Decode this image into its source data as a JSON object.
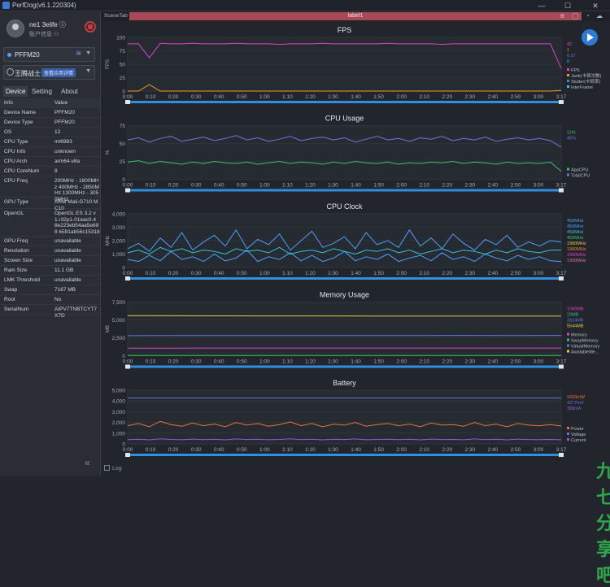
{
  "window": {
    "title": "PerfDog(v6.1.220304)",
    "min": "—",
    "max": "☐",
    "close": "✕"
  },
  "user": {
    "name": "ne1 3elife ⓘ",
    "account": "账户信息 ⚇"
  },
  "device_select": {
    "value": "PFFM20"
  },
  "app_select": {
    "value": "王腾战士",
    "tag": "查看应用详情"
  },
  "tabs": [
    "Device",
    "Setting",
    "About"
  ],
  "info_header": {
    "k": "Info",
    "v": "Value"
  },
  "info_rows": [
    {
      "k": "Device Name",
      "v": "PFFM20"
    },
    {
      "k": "Device Type",
      "v": "PFFM20"
    },
    {
      "k": "OS",
      "v": "12"
    },
    {
      "k": "CPU Type",
      "v": "mt6983"
    },
    {
      "k": "CPU Info",
      "v": "unknown"
    },
    {
      "k": "CPU Arch",
      "v": "arm64-v8a"
    },
    {
      "k": "CPU CoreNum",
      "v": "8"
    },
    {
      "k": "CPU Freq",
      "v": "200MHz - 1800MHz 400MHz - 2850MHz 1300MHz - 3050MHz"
    },
    {
      "k": "GPU Type",
      "v": "ARM Mali-G710 MC10"
    },
    {
      "k": "OpenGL",
      "v": "OpenGL ES 3.2 v1.r32p1-01eac0.4 8e223eb54aa5e698 6591ab56c15318"
    },
    {
      "k": "GPU Freq",
      "v": "unavailable"
    },
    {
      "k": "Resolution",
      "v": "unavailable"
    },
    {
      "k": "Screen Size",
      "v": "unavailable"
    },
    {
      "k": "Ram Size",
      "v": "11.1 GB"
    },
    {
      "k": "LMK Threshold",
      "v": "unavailable"
    },
    {
      "k": "Swap",
      "v": "7167 MB"
    },
    {
      "k": "Root",
      "v": "No"
    },
    {
      "k": "SerialNum",
      "v": "AIPV7TNBTCYT7X7D"
    }
  ],
  "scene": {
    "tab": "SceneTab",
    "label": "label1",
    "icons": "⊕ ◯ ◔ ☁"
  },
  "log": {
    "label": "Log"
  },
  "watermark": "九七分享吧",
  "x_ticks": [
    "0:00",
    "0:10",
    "0:20",
    "0:30",
    "0:40",
    "0:50",
    "1:00",
    "1:10",
    "1:20",
    "1:30",
    "1:40",
    "1:50",
    "2:00",
    "2:10",
    "2:20",
    "2:30",
    "2:40",
    "2:50",
    "3:00",
    "3:17"
  ],
  "chart_data": [
    {
      "type": "line",
      "title": "FPS",
      "ylabel": "FPS",
      "ylim": [
        0,
        100
      ],
      "yticks": [
        "0",
        "25",
        "50",
        "75",
        "100"
      ],
      "legend_values": [
        "42",
        "1",
        "6.37",
        "0"
      ],
      "legend": [
        "FPS",
        "Jank(卡顿次数)",
        "Stutter(卡顿率)",
        "InterFrame"
      ],
      "colors": [
        "#e040c8",
        "#f0a020",
        "#5a7ad8",
        "#30c8d8"
      ],
      "series": [
        {
          "name": "FPS",
          "values": [
            88,
            88,
            62,
            89,
            88,
            88,
            89,
            88,
            88,
            88,
            89,
            88,
            88,
            88,
            87,
            88,
            88,
            88,
            89,
            88,
            88,
            88,
            88,
            88,
            89,
            88,
            88,
            88,
            88,
            87,
            88,
            88,
            88,
            88,
            88,
            88,
            88,
            88,
            88,
            88,
            42
          ]
        },
        {
          "name": "Jank",
          "values": [
            0,
            0,
            12,
            0,
            0,
            0,
            0,
            0,
            0,
            0,
            0,
            0,
            0,
            0,
            0,
            0,
            0,
            0,
            0,
            0,
            0,
            0,
            0,
            0,
            0,
            0,
            0,
            0,
            0,
            0,
            0,
            0,
            0,
            0,
            0,
            0,
            0,
            0,
            0,
            0,
            1
          ]
        }
      ]
    },
    {
      "type": "line",
      "title": "CPU Usage",
      "ylabel": "%",
      "ylim": [
        0,
        75
      ],
      "yticks": [
        "0",
        "25",
        "50",
        "75"
      ],
      "legend_values": [
        "11%",
        "45%"
      ],
      "legend": [
        "AppCPU",
        "TotalCPU"
      ],
      "colors": [
        "#40c070",
        "#7a70e0"
      ],
      "series": [
        {
          "name": "AppCPU",
          "values": [
            24,
            26,
            22,
            25,
            23,
            21,
            24,
            22,
            25,
            23,
            22,
            24,
            21,
            23,
            25,
            22,
            24,
            23,
            21,
            24,
            22,
            25,
            23,
            22,
            24,
            21,
            23,
            22,
            24,
            23,
            25,
            22,
            24,
            23,
            21,
            24,
            22,
            23,
            22,
            24,
            11
          ]
        },
        {
          "name": "TotalCPU",
          "values": [
            55,
            58,
            52,
            57,
            60,
            53,
            56,
            59,
            54,
            57,
            61,
            55,
            58,
            53,
            56,
            60,
            54,
            57,
            59,
            55,
            58,
            52,
            56,
            60,
            55,
            57,
            53,
            58,
            56,
            60,
            54,
            57,
            55,
            59,
            53,
            56,
            58,
            55,
            57,
            54,
            45
          ]
        }
      ]
    },
    {
      "type": "line",
      "title": "CPU Clock",
      "ylabel": "MHz",
      "ylim": [
        0,
        4000
      ],
      "yticks": [
        "0",
        "1,000",
        "2,000",
        "3,000",
        "4,000"
      ],
      "legend_values": [
        "450MHz",
        "450MHz",
        "450MHz",
        "450MHz",
        "1900MHz",
        "1900MHz",
        "1900MHz",
        "1300MHz"
      ],
      "colors": [
        "#4aa0ff",
        "#4aa0ff",
        "#30c8d8",
        "#40c070",
        "#e8d040",
        "#f08030",
        "#e040c8",
        "#f07090"
      ],
      "series": [
        {
          "name": "CPU0",
          "values": [
            600,
            450,
            900,
            500,
            1200,
            600,
            800,
            450,
            1000,
            500,
            700,
            1300,
            450,
            800,
            600,
            1100,
            500,
            900,
            450,
            700,
            1200,
            500,
            800,
            600,
            1000,
            450,
            700,
            900,
            500,
            1100,
            600,
            800,
            450,
            1000,
            700,
            500,
            900,
            600,
            800,
            500,
            450
          ]
        },
        {
          "name": "CPU4",
          "values": [
            1400,
            1800,
            1200,
            2200,
            1500,
            2600,
            1300,
            1900,
            2400,
            1600,
            2800,
            1400,
            2100,
            1700,
            2500,
            1300,
            2000,
            2700,
            1500,
            1800,
            2300,
            1400,
            2600,
            1700,
            2000,
            1500,
            2800,
            1600,
            2200,
            1400,
            2500,
            1800,
            1300,
            2100,
            1700,
            2400,
            1500,
            1900,
            1600,
            2000,
            1900
          ]
        },
        {
          "name": "CPU7",
          "values": [
            1100,
            1300,
            1000,
            1500,
            1200,
            1400,
            1100,
            1300,
            1200,
            1000,
            1400,
            1200,
            1300,
            1100,
            1500,
            1000,
            1200,
            1300,
            1100,
            1400,
            1200,
            1000,
            1300,
            1200,
            1400,
            1100,
            1300,
            1000,
            1200,
            1400,
            1100,
            1300,
            1200,
            1000,
            1300,
            1100,
            1400,
            1200,
            1100,
            1300,
            1300
          ]
        }
      ]
    },
    {
      "type": "line",
      "title": "Memory Usage",
      "ylabel": "MB",
      "ylim": [
        0,
        7500
      ],
      "yticks": [
        "0",
        "2,500",
        "5,000",
        "7,500"
      ],
      "legend_values": [
        "1069MB",
        "23MB",
        "2824MB",
        "5544MB"
      ],
      "legend": [
        "Memory",
        "SwapMemory",
        "VirtualMemory",
        "AvailableMe..."
      ],
      "colors": [
        "#e040c8",
        "#40c070",
        "#5a7ad8",
        "#e8d040"
      ],
      "series": [
        {
          "name": "Memory",
          "values": [
            1050,
            1060,
            1070,
            1065,
            1068,
            1070,
            1066,
            1069,
            1070,
            1069
          ]
        },
        {
          "name": "SwapMemory",
          "values": [
            23,
            23,
            23,
            23,
            23,
            23,
            23,
            23,
            23,
            23
          ]
        },
        {
          "name": "VirtualMemory",
          "values": [
            2800,
            2810,
            2815,
            2820,
            2818,
            2822,
            2820,
            2824,
            2823,
            2824
          ]
        },
        {
          "name": "AvailableMemory",
          "values": [
            5600,
            5580,
            5570,
            5560,
            5555,
            5550,
            5548,
            5546,
            5545,
            5544
          ]
        }
      ]
    },
    {
      "type": "line",
      "title": "Battery",
      "ylim": [
        0,
        5000
      ],
      "yticks": [
        "0",
        "1,000",
        "2,000",
        "3,000",
        "4,000",
        "5,000"
      ],
      "legend_values": [
        "1663mW",
        "4277mV",
        "388mA"
      ],
      "legend": [
        "Power",
        "Voltage",
        "Current"
      ],
      "colors": [
        "#f07040",
        "#5a7ad8",
        "#8a60d8"
      ],
      "series": [
        {
          "name": "Power",
          "values": [
            1700,
            1900,
            1600,
            2100,
            1800,
            1650,
            1950,
            1700,
            1850,
            1600,
            2000,
            1750,
            1900,
            1650,
            1800,
            2050,
            1700,
            1900,
            1600,
            1850,
            1750,
            2000,
            1650,
            1800,
            1900,
            1700,
            1850,
            1600,
            1950,
            1750,
            1800,
            1650,
            2000,
            1700,
            1850,
            1600,
            1900,
            1750,
            1700,
            1800,
            1663
          ]
        },
        {
          "name": "Voltage",
          "values": [
            4280,
            4280,
            4279,
            4279,
            4278,
            4278,
            4278,
            4277,
            4277,
            4277
          ]
        },
        {
          "name": "Current",
          "values": [
            400,
            440,
            380,
            480,
            420,
            390,
            450,
            400,
            430,
            380,
            460,
            410,
            440,
            390,
            420,
            470,
            400,
            440,
            380,
            430,
            410,
            460,
            390,
            420,
            440,
            400,
            430,
            380,
            450,
            410,
            420,
            390,
            460,
            400,
            430,
            380,
            440,
            410,
            400,
            420,
            388
          ]
        }
      ]
    }
  ]
}
